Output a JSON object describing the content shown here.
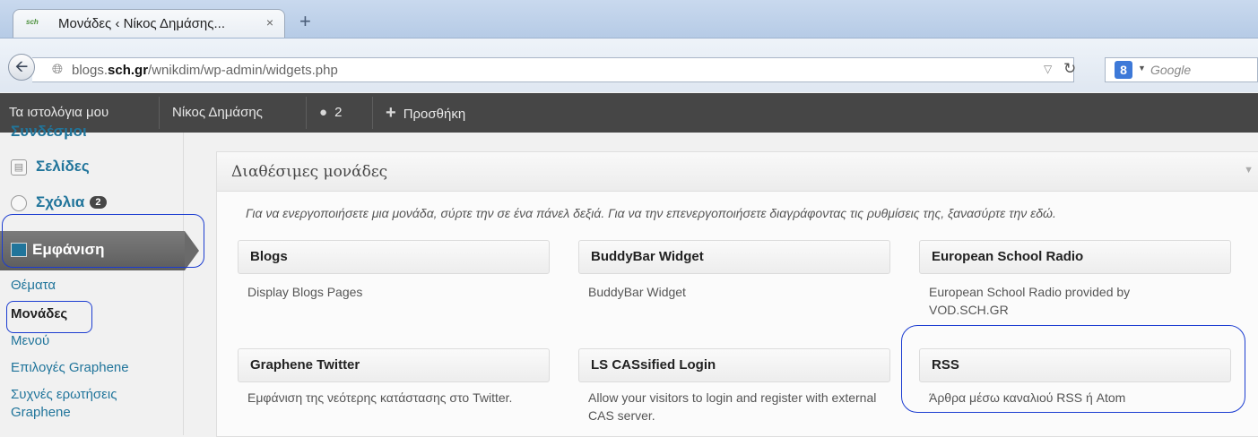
{
  "browser": {
    "tab": {
      "favicon": "sch",
      "title": "Μονάδες ‹ Νίκος Δημάσης...",
      "close": "×"
    },
    "new_tab": "+",
    "url": {
      "domain_prefix": "blogs.",
      "domain_bold": "sch.gr",
      "path": "/wnikdim/wp-admin/widgets.php"
    },
    "search": {
      "engine": "8",
      "placeholder": "Google"
    }
  },
  "admin_bar": {
    "my_blogs": "Τα ιστολόγια μου",
    "site_name": "Νίκος Δημάσης",
    "comments_count": "2",
    "new": "Προσθήκη"
  },
  "sidebar": {
    "cut_item": "Συνδέσμοι",
    "pages": "Σελίδες",
    "comments": "Σχόλια",
    "comments_badge": "2",
    "appearance": "Εμφάνιση",
    "submenu": [
      "Θέματα",
      "Μονάδες",
      "Μενού",
      "Επιλογές Graphene",
      "Συχνές ερωτήσεις",
      "Graphene"
    ]
  },
  "main": {
    "panel_title": "Διαθέσιμες μονάδες",
    "description": "Για να ενεργοποιήσετε μια μονάδα, σύρτε την σε ένα πάνελ δεξιά. Για να την επενεργοποιήσετε διαγράφοντας τις ρυθμίσεις της, ξανασύρτε την εδώ.",
    "widgets": [
      {
        "title": "Blogs",
        "desc": "Display Blogs Pages"
      },
      {
        "title": "BuddyBar Widget",
        "desc": "BuddyBar Widget"
      },
      {
        "title": "European School Radio",
        "desc": "European School Radio provided by VOD.SCH.GR"
      },
      {
        "title": "Graphene Twitter",
        "desc": "Εμφάνιση της νεότερης κατάστασης στο Twitter."
      },
      {
        "title": "LS CASsified Login",
        "desc": "Allow your visitors to login and register with external CAS server."
      },
      {
        "title": "RSS",
        "desc": "Άρθρα μέσω καναλιού RSS ή Atom"
      }
    ]
  },
  "colors": {
    "link": "#21759b",
    "admin_bar": "#464646",
    "annotation": "#1c3dd1"
  }
}
